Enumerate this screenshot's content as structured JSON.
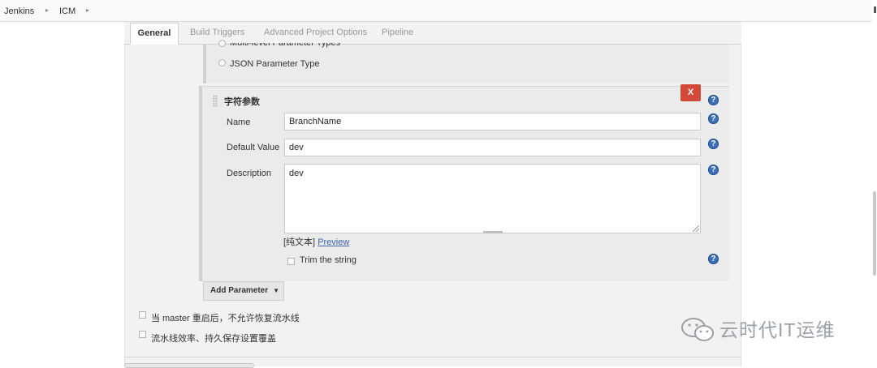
{
  "breadcrumb": {
    "items": [
      "Jenkins",
      "ICM"
    ],
    "separator": "▸"
  },
  "tabs": {
    "general": "General",
    "build_triggers": "Build Triggers",
    "advanced_project_options": "Advanced Project Options",
    "pipeline": "Pipeline",
    "active": "General"
  },
  "parameter_types": {
    "multi_level_partial": "Multi-level Parameter Types",
    "json": "JSON Parameter Type"
  },
  "string_parameter": {
    "title": "字符参数",
    "delete_label": "X",
    "help_glyph": "?",
    "name_label": "Name",
    "name_value": "BranchName",
    "default_value_label": "Default Value",
    "default_value": "dev",
    "description_label": "Description",
    "description_value": "dev",
    "plaintext_label": "[纯文本]",
    "preview_link": "Preview",
    "trim_label": "Trim the string"
  },
  "add_parameter": {
    "label": "Add Parameter",
    "caret": "▼"
  },
  "options": {
    "no_resume_on_restart": "当 master 重启后，不允许恢复流水线",
    "durability": "流水线效率、持久保存设置覆盖"
  },
  "watermark": {
    "text": "云时代IT运维",
    "icon": "wechat-icon"
  },
  "colors": {
    "delete": "#d24939",
    "help": "#3b6fb6",
    "link": "#3e63ad"
  }
}
